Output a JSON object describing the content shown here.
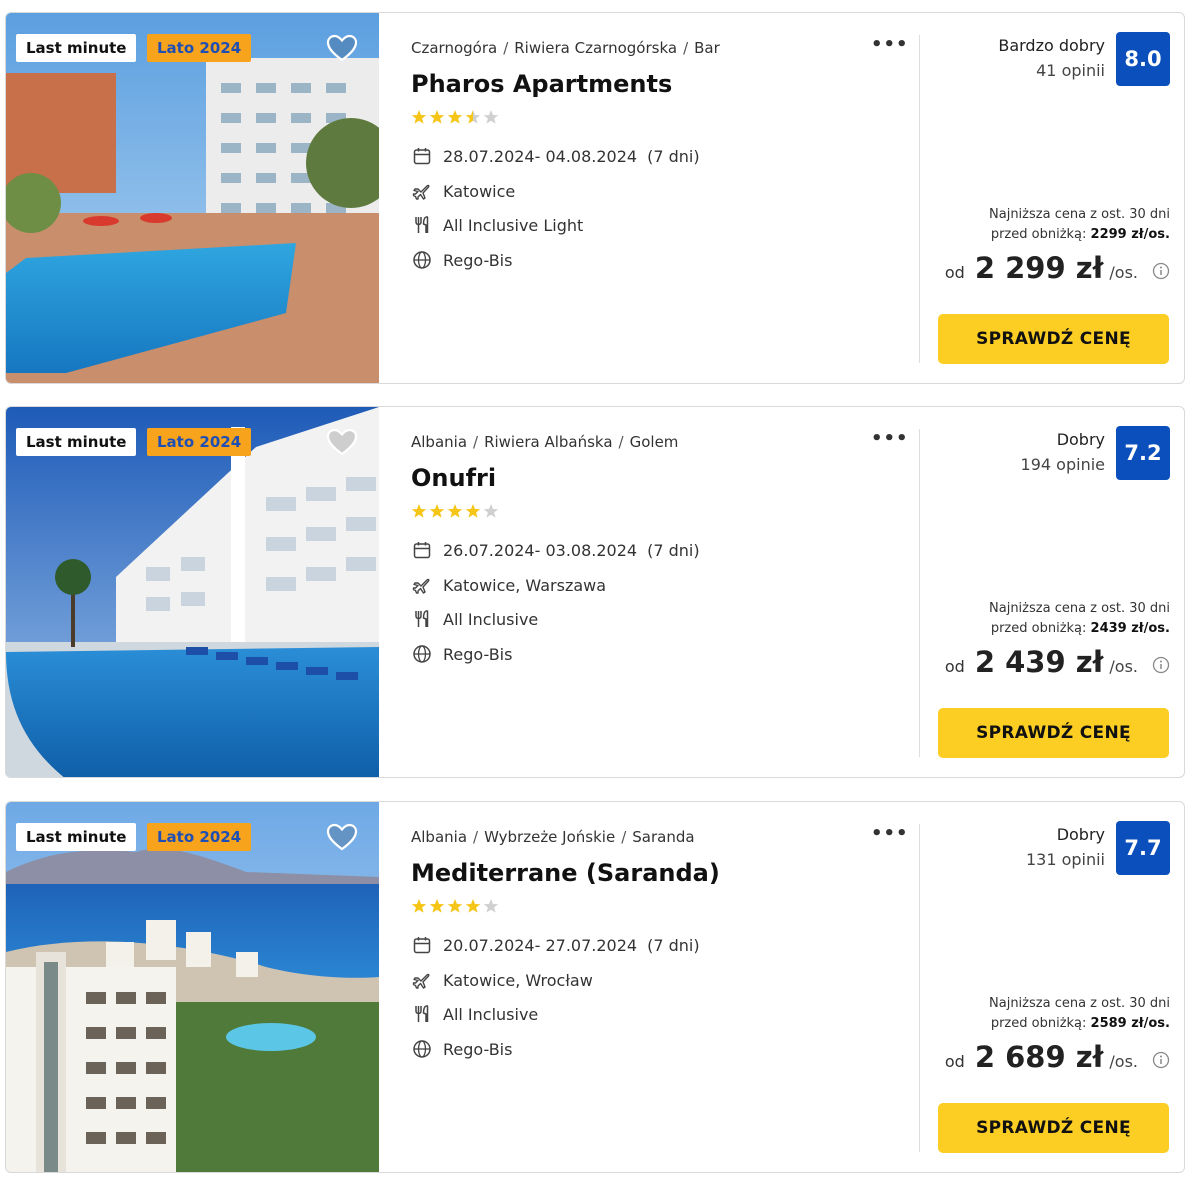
{
  "offers": [
    {
      "badges": [
        "Last minute",
        "Lato 2024"
      ],
      "location": [
        "Czarnogóra",
        "Riwiera Czarnogórska",
        "Bar"
      ],
      "name": "Pharos Apartments",
      "stars": 3.5,
      "dates": "28.07.2024- 04.08.2024",
      "duration": "(7 dni)",
      "departure": "Katowice",
      "board": "All Inclusive Light",
      "operator": "Rego-Bis",
      "rating_label": "Bardzo dobry",
      "reviews": "41 opinii",
      "score": "8.0",
      "lowest_price_line1": "Najniższa cena z ost. 30 dni",
      "lowest_price_prefix": "przed obniżką:",
      "lowest_price_value": "2299 zł/os.",
      "price_prefix": "od",
      "price": "2 299 zł",
      "price_unit": "/os.",
      "cta_label": "SPRAWDŹ CENĘ"
    },
    {
      "badges": [
        "Last minute",
        "Lato 2024"
      ],
      "location": [
        "Albania",
        "Riwiera Albańska",
        "Golem"
      ],
      "name": "Onufri",
      "stars": 4,
      "dates": "26.07.2024- 03.08.2024",
      "duration": "(7 dni)",
      "departure": "Katowice, Warszawa",
      "board": "All Inclusive",
      "operator": "Rego-Bis",
      "rating_label": "Dobry",
      "reviews": "194 opinie",
      "score": "7.2",
      "lowest_price_line1": "Najniższa cena z ost. 30 dni",
      "lowest_price_prefix": "przed obniżką:",
      "lowest_price_value": "2439 zł/os.",
      "price_prefix": "od",
      "price": "2 439 zł",
      "price_unit": "/os.",
      "cta_label": "SPRAWDŹ CENĘ"
    },
    {
      "badges": [
        "Last minute",
        "Lato 2024"
      ],
      "location": [
        "Albania",
        "Wybrzeże Jońskie",
        "Saranda"
      ],
      "name": "Mediterrane (Saranda)",
      "stars": 4,
      "dates": "20.07.2024- 27.07.2024",
      "duration": "(7 dni)",
      "departure": "Katowice, Wrocław",
      "board": "All Inclusive",
      "operator": "Rego-Bis",
      "rating_label": "Dobry",
      "reviews": "131 opinii",
      "score": "7.7",
      "lowest_price_line1": "Najniższa cena z ost. 30 dni",
      "lowest_price_prefix": "przed obniżką:",
      "lowest_price_value": "2589 zł/os.",
      "price_prefix": "od",
      "price": "2 689 zł",
      "price_unit": "/os.",
      "cta_label": "SPRAWDŹ CENĘ"
    }
  ],
  "icons": {
    "favorite": "heart-outline-icon",
    "more": "more-dots-icon",
    "date": "calendar-icon",
    "departure": "plane-icon",
    "board": "cutlery-icon",
    "operator": "globe-icon",
    "price_info": "info-icon"
  },
  "colors": {
    "score_bg": "#0b4fbd",
    "cta_bg": "#fcce23",
    "season_badge_bg": "#f7a41c",
    "season_badge_text": "#1f4fb4",
    "star_full": "#f5c518",
    "star_empty": "#d0d0d0"
  }
}
